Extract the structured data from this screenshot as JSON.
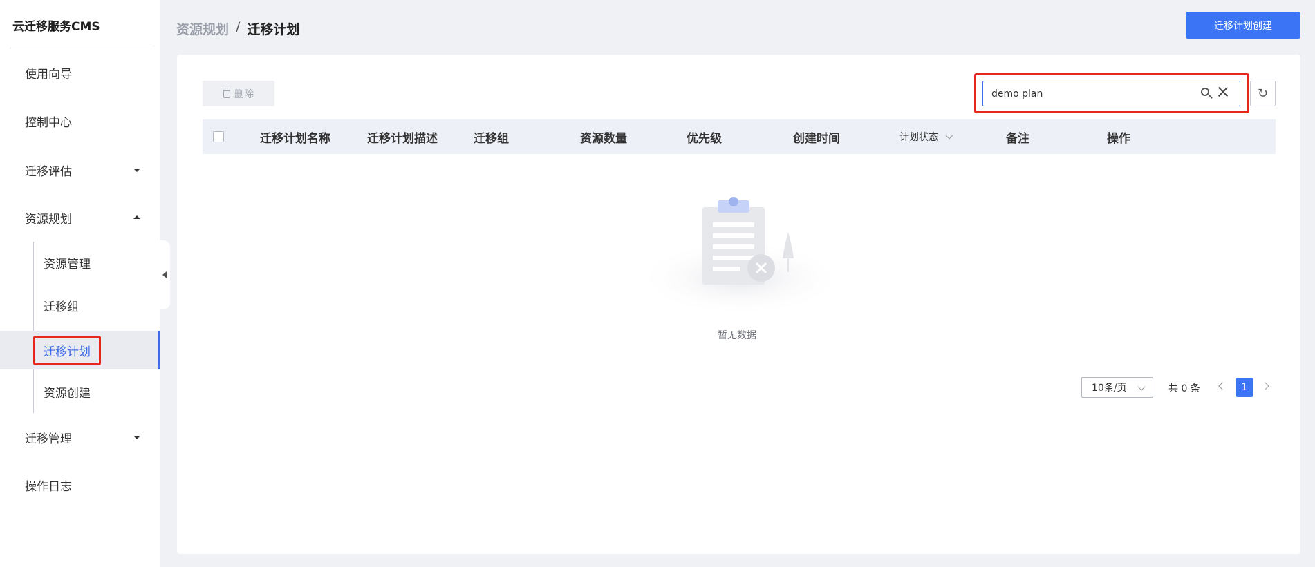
{
  "app": {
    "brand": "云迁移服务CMS"
  },
  "sidebar": {
    "items": [
      {
        "label": "使用向导"
      },
      {
        "label": "控制中心"
      },
      {
        "label": "迁移评估"
      },
      {
        "label": "资源规划"
      },
      {
        "label": "迁移管理"
      },
      {
        "label": "操作日志"
      }
    ],
    "sub_items": [
      {
        "label": "资源管理"
      },
      {
        "label": "迁移组"
      },
      {
        "label": "迁移计划"
      },
      {
        "label": "资源创建"
      }
    ]
  },
  "breadcrumb": {
    "parent": "资源规划",
    "separator": "/",
    "current": "迁移计划"
  },
  "toolbar": {
    "create_label": "迁移计划创建",
    "delete_label": "删除"
  },
  "search": {
    "value": "demo plan"
  },
  "table": {
    "columns": [
      "迁移计划名称",
      "迁移计划描述",
      "迁移组",
      "资源数量",
      "优先级",
      "创建时间",
      "计划状态",
      "备注",
      "操作"
    ],
    "empty_text": "暂无数据"
  },
  "pagination": {
    "page_size": "10条/页",
    "total": "共 0 条",
    "current_page": "1"
  },
  "colors": {
    "accent": "#3b74f5",
    "highlight": "#e5271c"
  },
  "icons": [
    "trash-icon",
    "search-icon",
    "close-icon",
    "refresh-icon",
    "chevron-down-icon",
    "caret-down-icon",
    "caret-up-icon",
    "collapse-left-icon"
  ]
}
